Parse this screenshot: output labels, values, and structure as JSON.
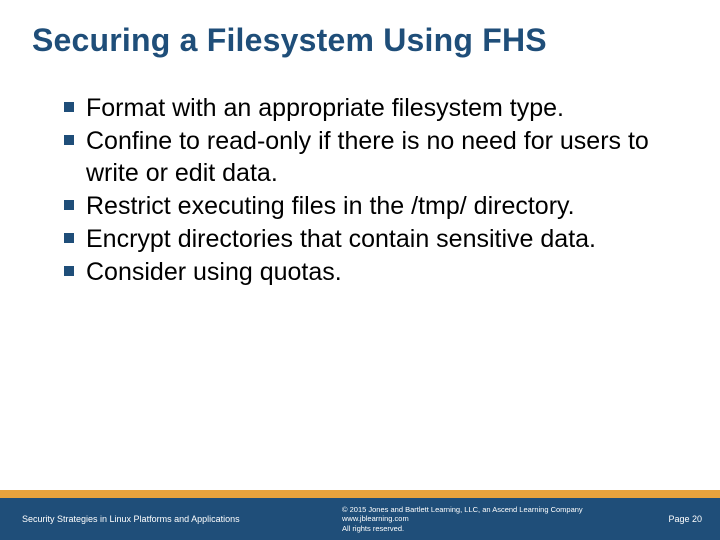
{
  "title": "Securing a Filesystem Using FHS",
  "bullets": [
    "Format with an appropriate filesystem type.",
    "Confine to read-only if there is no need for users to write or edit data.",
    "Restrict executing files in the /tmp/ directory.",
    "Encrypt directories that contain sensitive data.",
    "Consider using quotas."
  ],
  "footer": {
    "left": "Security Strategies in Linux Platforms and Applications",
    "copyright": "© 2015 Jones and Bartlett Learning, LLC, an Ascend Learning Company",
    "url": "www.jblearning.com",
    "rights": "All rights reserved.",
    "page": "Page 20"
  }
}
